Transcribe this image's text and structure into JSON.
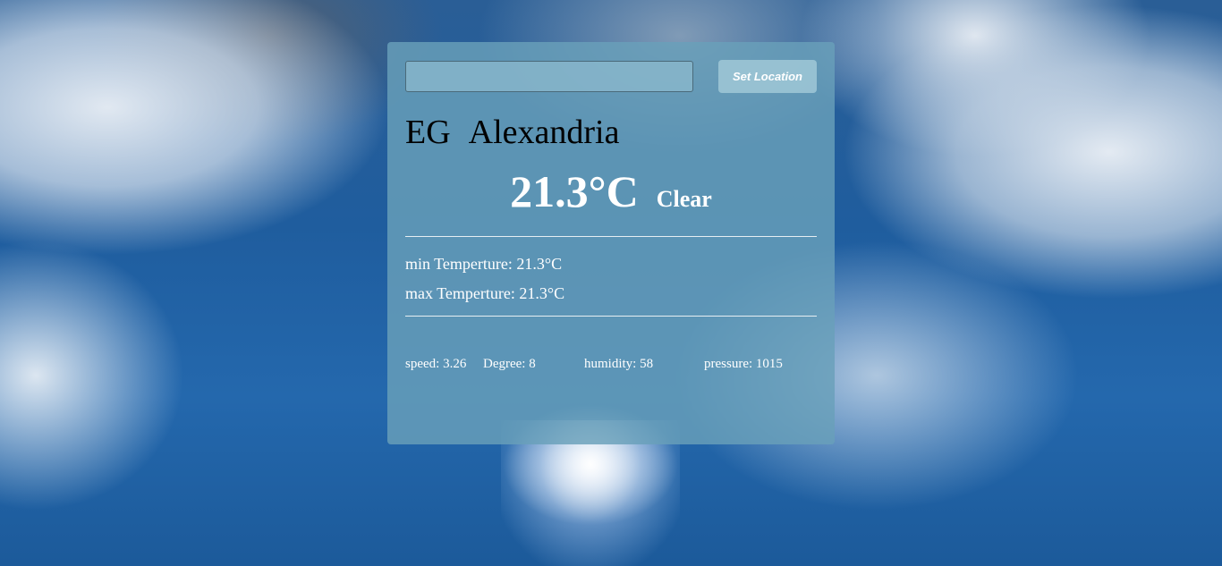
{
  "colors": {
    "card_background": "#69a0b9",
    "text_primary": "#ffffff",
    "location_text": "#000000",
    "button_background": "#a0c8d7"
  },
  "search": {
    "input_value": "",
    "placeholder": "",
    "button_label": "Set Location"
  },
  "location": {
    "country": "EG",
    "city": "Alexandria"
  },
  "current": {
    "temperature": "21.3°C",
    "condition": "Clear"
  },
  "range": {
    "min_label": "min Temperture: ",
    "min_value": "21.3°C",
    "max_label": "max Temperture: ",
    "max_value": "21.3°C"
  },
  "stats": {
    "speed": "speed: 3.26",
    "degree": "Degree: 8",
    "humidity": "humidity: 58",
    "pressure": "pressure: 1015"
  }
}
